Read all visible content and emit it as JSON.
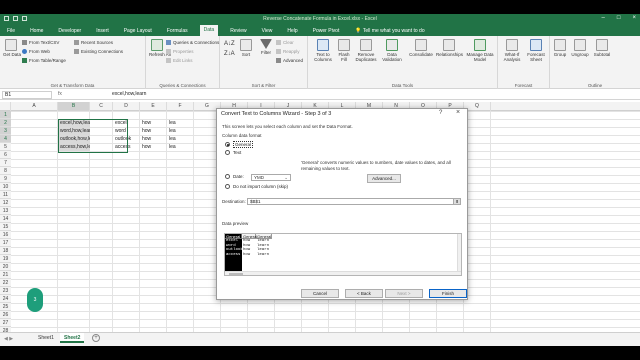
{
  "window": {
    "title": "Reverse Concatenate Formula in Excel.xlsx - Excel"
  },
  "ribbon": {
    "tabs": [
      "File",
      "Home",
      "Developer",
      "Insert",
      "Page Layout",
      "Formulas",
      "Data",
      "Review",
      "View",
      "Help",
      "Power Pivot"
    ],
    "active_tab": "Data",
    "tell_me": "Tell me what you want to do",
    "get_transform": {
      "get_data": "Get Data",
      "from_text_csv": "From Text/CSV",
      "from_web": "From Web",
      "from_table_range": "From Table/Range",
      "recent_sources": "Recent Sources",
      "existing_connections": "Existing Connections",
      "label": "Get & Transform Data"
    },
    "queries": {
      "refresh_all": "Refresh All",
      "queries_connections": "Queries & Connections",
      "properties": "Properties",
      "edit_links": "Edit Links",
      "label": "Queries & Connections"
    },
    "sort_filter": {
      "sort": "Sort",
      "filter": "Filter",
      "clear": "Clear",
      "reapply": "Reapply",
      "advanced": "Advanced",
      "label": "Sort & Filter"
    },
    "data_tools": {
      "text_to_columns": "Text to Columns",
      "flash_fill": "Flash Fill",
      "remove_duplicates": "Remove Duplicates",
      "data_validation": "Data Validation",
      "consolidate": "Consolidate",
      "relationships": "Relationships",
      "manage_data_model": "Manage Data Model",
      "label": "Data Tools"
    },
    "forecast": {
      "what_if": "What-If Analysis",
      "forecast_sheet": "Forecast Sheet",
      "label": "Forecast"
    },
    "outline": {
      "group": "Group",
      "ungroup": "Ungroup",
      "subtotal": "Subtotal",
      "label": "Outline"
    }
  },
  "formula_bar": {
    "name_box": "B1",
    "fx": "fx",
    "formula": "excel,how,learn"
  },
  "grid": {
    "columns": [
      "A",
      "B",
      "C",
      "D",
      "E",
      "F",
      "G",
      "H",
      "I",
      "J",
      "K",
      "L",
      "M",
      "N",
      "O",
      "P",
      "Q"
    ],
    "rows": [
      "1",
      "2",
      "3",
      "4",
      "5",
      "6",
      "7",
      "8",
      "9",
      "10",
      "11",
      "12",
      "13",
      "14",
      "15",
      "16",
      "17",
      "18",
      "19",
      "20",
      "21",
      "22",
      "23",
      "24",
      "25",
      "26",
      "27",
      "28"
    ],
    "selected_column": "B",
    "selected_rows": [
      "1",
      "2",
      "3",
      "4"
    ],
    "column_b": [
      "excel,how,learn",
      "word,how,learn",
      "outlook,how,learn",
      "access,how,learn"
    ],
    "column_d": [
      "excel",
      "word",
      "outlook",
      "access"
    ],
    "column_e": [
      "how",
      "how",
      "how",
      "how"
    ],
    "column_f": [
      "lea",
      "lea",
      "lea",
      "lea"
    ]
  },
  "sheets": {
    "tabs": [
      "Sheet1",
      "Sheet2"
    ],
    "active": "Sheet2",
    "add": "+",
    "nav": "◀ ▶"
  },
  "badge": {
    "text": "3"
  },
  "dialog": {
    "title": "Convert Text to Columns Wizard - Step 3 of 3",
    "help": "?",
    "close": "×",
    "instructions": "This screen lets you select each column and set the Data Format.",
    "column_format_label": "Column data format",
    "options": [
      "General",
      "Text",
      "Date:",
      "Do not import column (skip)"
    ],
    "selected_option": "General",
    "date_format": "YMD",
    "general_note_line1": "'General' converts numeric values to numbers, date values to dates, and all",
    "general_note_line2": "remaining values to text.",
    "advanced_button": "Advanced...",
    "destination_label": "Destination:",
    "destination_value": "$B$1",
    "collapse_icon": "⬆",
    "preview_label": "Data preview",
    "preview_columns": [
      {
        "header": "General",
        "values": [
          "excel",
          "word",
          "outlook",
          "access"
        ]
      },
      {
        "header": "General",
        "values": [
          "how",
          "how",
          "how",
          "how"
        ]
      },
      {
        "header": "General",
        "values": [
          "learn",
          "learn",
          "learn",
          "learn"
        ]
      }
    ],
    "buttons": {
      "cancel": "Cancel",
      "back": "< Back",
      "next": "Next >",
      "finish": "Finish"
    }
  },
  "colors": {
    "excel_green": "#217346",
    "badge": "#1e9e7b",
    "selection_fill": "#d9d9d9"
  }
}
